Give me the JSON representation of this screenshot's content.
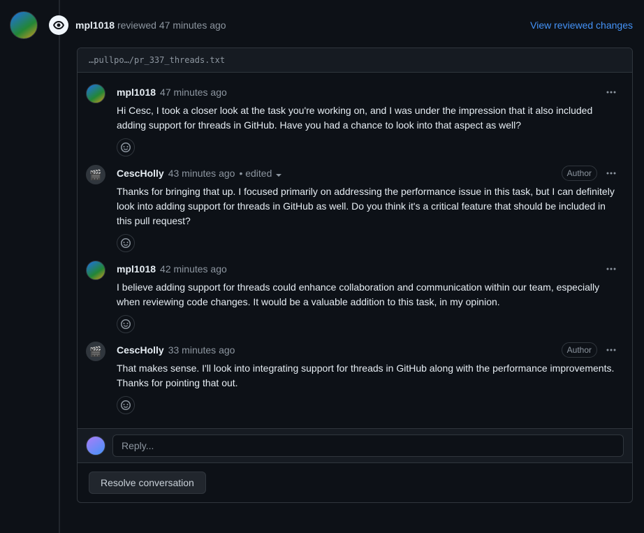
{
  "review": {
    "user": "mpl1018",
    "action": "reviewed",
    "time": "47 minutes ago",
    "view_changes_label": "View reviewed changes"
  },
  "file_path": "…pullpo…/pr_337_threads.txt",
  "comments": [
    {
      "user": "mpl1018",
      "avatar": "mpl",
      "time": "47 minutes ago",
      "edited": false,
      "is_author": false,
      "body": "Hi Cesc, I took a closer look at the task you're working on, and I was under the impression that it also included adding support for threads in GitHub. Have you had a chance to look into that aspect as well?"
    },
    {
      "user": "CescHolly",
      "avatar": "cesc",
      "time": "43 minutes ago",
      "edited": true,
      "edited_label": "edited",
      "is_author": true,
      "author_label": "Author",
      "body": "Thanks for bringing that up. I focused primarily on addressing the performance issue in this task, but I can definitely look into adding support for threads in GitHub as well. Do you think it's a critical feature that should be included in this pull request?"
    },
    {
      "user": "mpl1018",
      "avatar": "mpl",
      "time": "42 minutes ago",
      "edited": false,
      "is_author": false,
      "body": "I believe adding support for threads could enhance collaboration and communication within our team, especially when reviewing code changes. It would be a valuable addition to this task, in my opinion."
    },
    {
      "user": "CescHolly",
      "avatar": "cesc",
      "time": "33 minutes ago",
      "edited": false,
      "is_author": true,
      "author_label": "Author",
      "body": "That makes sense. I'll look into integrating support for threads in GitHub along with the performance improvements. Thanks for pointing that out."
    }
  ],
  "reply": {
    "placeholder": "Reply..."
  },
  "resolve_label": "Resolve conversation",
  "separator": " • "
}
